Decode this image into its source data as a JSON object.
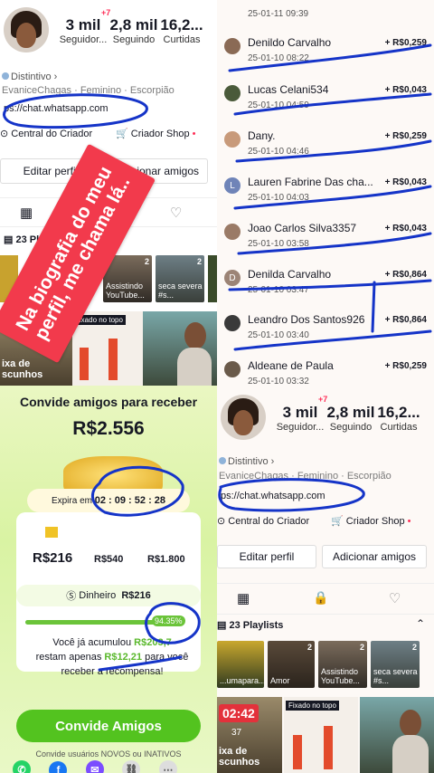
{
  "profile_top": {
    "stats": [
      {
        "num": "3 mil",
        "label": "Seguidor..."
      },
      {
        "num": "2,8 mil",
        "label": "Seguindo"
      },
      {
        "num": "16,2...",
        "label": "Curtidas"
      }
    ],
    "new_badge": "+7",
    "tag": "Distintivo",
    "bio_line": "EvaniceChagas · Feminino · Escorpião",
    "link": "https://chat.whatsapp.com",
    "link_visible": "ps://chat.whatsapp.com",
    "creator_center": "Central do Criador",
    "creator_shop": "Criador Shop",
    "edit_profile": "Editar perfil",
    "add_friends": "Adicionar amigos",
    "playlists": "23 Playlists",
    "thumbs": [
      {
        "count": "2",
        "caption": "Assistindo YouTube..."
      },
      {
        "count": "2",
        "caption": "seca severa #s..."
      }
    ],
    "pinned": "Fixado no topo",
    "caption_left": "ixa de scunhos"
  },
  "sticker_text": "Na biografia do meu perfil, me chama lá..",
  "transactions": [
    {
      "name": "",
      "date": "25-01-11 09:39",
      "amount": ""
    },
    {
      "name": "Denildo Carvalho",
      "date": "25-01-10 08:22",
      "amount": "+ R$0,259"
    },
    {
      "name": "Lucas Celani534",
      "date": "25-01-10 04:59",
      "amount": "+ R$0,043"
    },
    {
      "name": "Dany.",
      "date": "25-01-10 04:46",
      "amount": "+ R$0,259"
    },
    {
      "name": "Lauren Fabrine Das cha...",
      "date": "25-01-10 04:03",
      "amount": "+ R$0,043"
    },
    {
      "name": "Joao Carlos Silva3357",
      "date": "25-01-10 03:58",
      "amount": "+ R$0,043"
    },
    {
      "name": "Denilda Carvalho",
      "date": "25-01-10 03:47",
      "amount": "+ R$0,864"
    },
    {
      "name": "Leandro Dos Santos926",
      "date": "25-01-10 03:40",
      "amount": "+ R$0,864"
    },
    {
      "name": "Aldeane de Paula",
      "date": "25-01-10 03:32",
      "amount": "+ R$0,259"
    }
  ],
  "reward": {
    "title": "Convide amigos para receber",
    "total": "R$2.556",
    "expires_label": "Expira em",
    "timer": "02 : 09 : 52 : 28",
    "milestones": [
      "R$216",
      "R$540",
      "R$1.800"
    ],
    "cash_label": "Dinheiro",
    "cash_value": "R$216",
    "progress_pct": "94.35%",
    "progress_fraction": 0.9435,
    "msg_1": "Você já acumulou",
    "msg_acc": "R$203,7",
    "msg_2": "restam apenas",
    "msg_rest": "R$12,21",
    "msg_3": "para você",
    "msg_4": "receber a recompensa!",
    "cta": "Convide Amigos",
    "footer": "Convide usuários NOVOS ou INATIVOS"
  },
  "profile_bottom": {
    "timer_overlay": "02:42",
    "timer_sub": "37",
    "caption_right": "Amor",
    "caption_thumb": "...umapara..."
  },
  "colors": {
    "accent_red": "#fe2c55",
    "ink_blue": "#1534c8",
    "reward_green": "#59b82b",
    "sticker_red": "#f23a4c"
  }
}
